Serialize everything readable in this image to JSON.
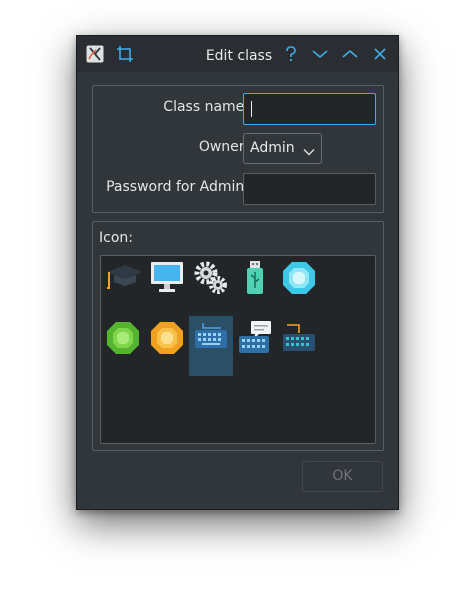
{
  "window": {
    "title": "Edit class",
    "icons": {
      "app": "app-logo-icon",
      "crop": "crop-icon",
      "help": "help-icon",
      "minimize": "chevron-down-icon",
      "maximize": "chevron-up-icon",
      "close": "close-icon"
    }
  },
  "form": {
    "class_name_label": "Class name:",
    "class_name_value": "",
    "owner_label": "Owner:",
    "owner_value": "Admin",
    "password_label": "Password for Admin:",
    "password_value": ""
  },
  "icons_section": {
    "label": "Icon:",
    "items": [
      {
        "name": "graduation-cap-icon",
        "selected": false
      },
      {
        "name": "monitor-icon",
        "selected": false
      },
      {
        "name": "gears-icon",
        "selected": false
      },
      {
        "name": "usb-stick-icon",
        "selected": false
      },
      {
        "name": "cyan-gem-icon",
        "selected": false
      },
      {
        "name": "green-gem-icon",
        "selected": false
      },
      {
        "name": "orange-gem-icon",
        "selected": false
      },
      {
        "name": "keyboard-icon",
        "selected": true
      },
      {
        "name": "keyboard-chat-icon",
        "selected": false
      },
      {
        "name": "keyboard-cable-icon",
        "selected": false
      }
    ]
  },
  "buttons": {
    "ok_label": "OK"
  },
  "colors": {
    "accent": "#3daee9",
    "window_bg": "#31363b",
    "field_bg": "#232629",
    "selection": "#2b4f66"
  }
}
